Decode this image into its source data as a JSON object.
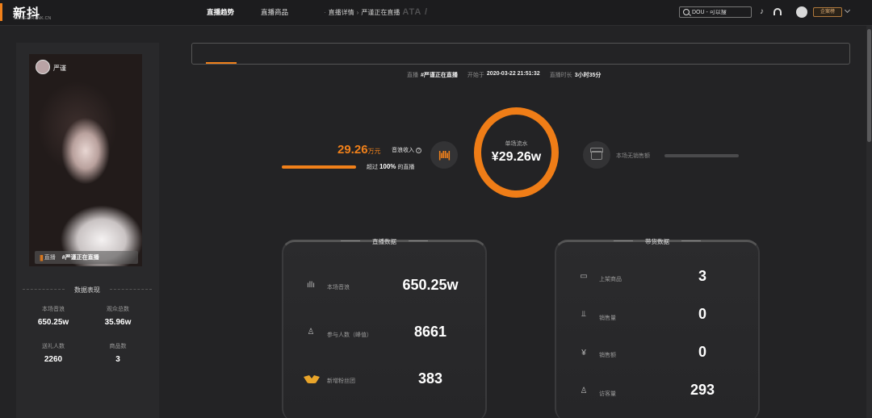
{
  "header": {
    "logo": "新抖",
    "logo_sub": "XD.NEWRANK.CN",
    "breadcrumb": [
      "直播详情",
      "严谨正在直播"
    ],
    "breadcrumb_ghost": "ATA /",
    "search_placeholder": "DOU - 可以搜",
    "plan_badge": "企案榜"
  },
  "cover": {
    "anchor_name": "严谨",
    "live_label": "直播",
    "topic": "#严谨正在直播"
  },
  "stats": {
    "title": "数据表现",
    "items": [
      {
        "label": "本场音浪",
        "value": "650.25w"
      },
      {
        "label": "观众总数",
        "value": "35.96w"
      },
      {
        "label": "送礼人数",
        "value": "2260"
      },
      {
        "label": "商品数",
        "value": "3"
      }
    ]
  },
  "tabs": [
    {
      "label": "直播趋势",
      "active": true
    },
    {
      "label": "直播商品",
      "active": false
    }
  ],
  "live_info": {
    "live_label": "直播",
    "live_value": "#严谨正在直播",
    "start_label": "开始于",
    "start_value": "2020-03-22 21:51:32",
    "duration_label": "直播时长",
    "duration_value": "3小时35分"
  },
  "income": {
    "value": "29.26",
    "unit": "万元",
    "label": "音浪收入",
    "rank_prefix": "超过",
    "rank_value": "100%",
    "rank_suffix": "的直播",
    "progress_percent": 100
  },
  "flow": {
    "label": "单场流水",
    "value": "¥29.26w"
  },
  "no_sales_label": "本场无销售额",
  "live_card": {
    "title": "直播数据",
    "rows": [
      {
        "icon": "sound-wave-icon",
        "label": "本场音浪",
        "value": "650.25w"
      },
      {
        "icon": "people-icon",
        "label": "参与人数（峰值）",
        "value": "8661"
      },
      {
        "icon": "fans-club-icon",
        "label": "新增粉丝团",
        "value": "383"
      }
    ]
  },
  "goods_card": {
    "title": "带货数据",
    "rows": [
      {
        "icon": "shop-icon",
        "label": "上架商品",
        "value": "3"
      },
      {
        "icon": "chart-icon",
        "label": "销售量",
        "value": "0"
      },
      {
        "icon": "yen-icon",
        "label": "销售额",
        "value": "0"
      },
      {
        "icon": "visitor-icon",
        "label": "访客量",
        "value": "293"
      }
    ]
  }
}
